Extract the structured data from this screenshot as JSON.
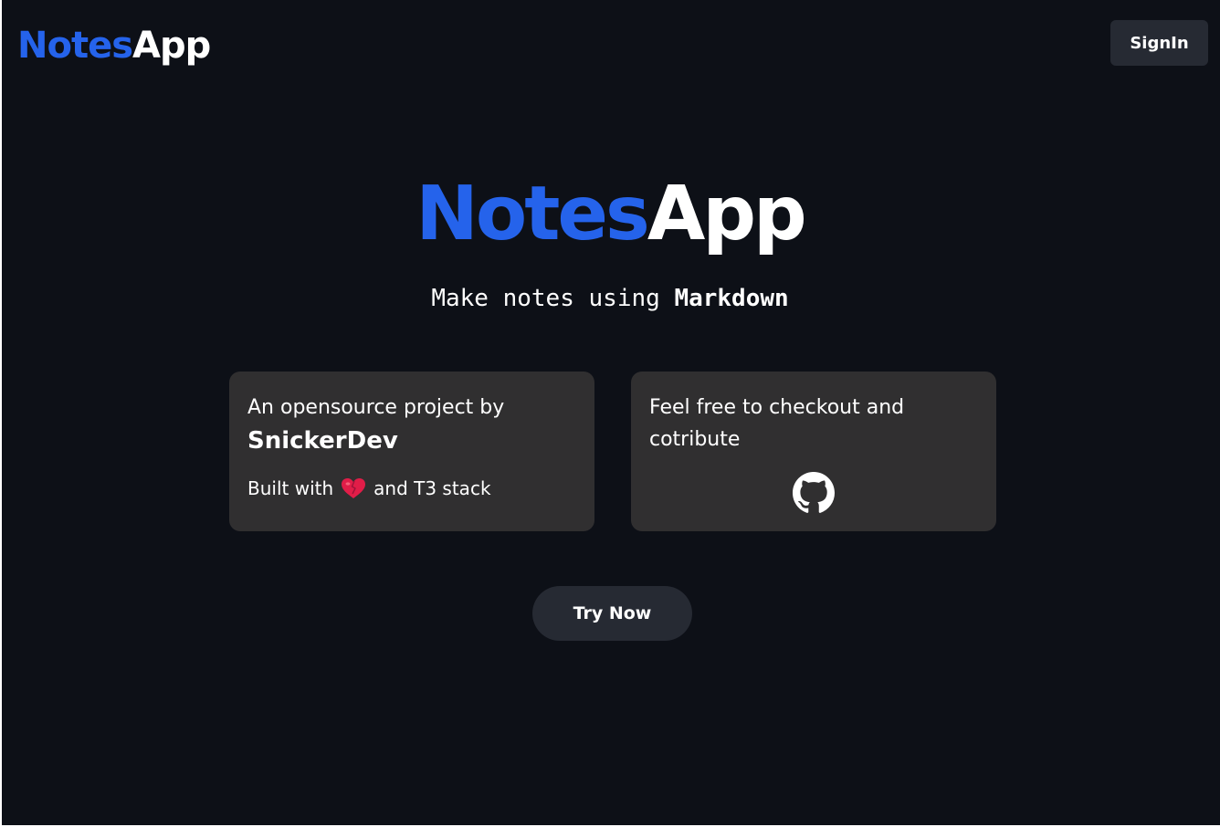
{
  "header": {
    "logo_part1": "Notes",
    "logo_part2": "App",
    "signin_label": "SignIn"
  },
  "hero": {
    "title_part1": "Notes",
    "title_part2": "App",
    "tagline_prefix": "Make notes using ",
    "tagline_bold": "Markdown"
  },
  "cards": {
    "about": {
      "intro": "An opensource project by",
      "author": "SnickerDev",
      "built_prefix": "Built with",
      "built_icon": "heart-icon",
      "built_suffix": "and T3 stack"
    },
    "contribute": {
      "text": "Feel free to checkout and cotribute",
      "icon": "github-icon"
    }
  },
  "cta": {
    "label": "Try Now"
  },
  "colors": {
    "background": "#0d1017",
    "brand_blue": "#2563eb",
    "card": "#302f30",
    "button": "#262a33",
    "heart": "#e11d48"
  }
}
